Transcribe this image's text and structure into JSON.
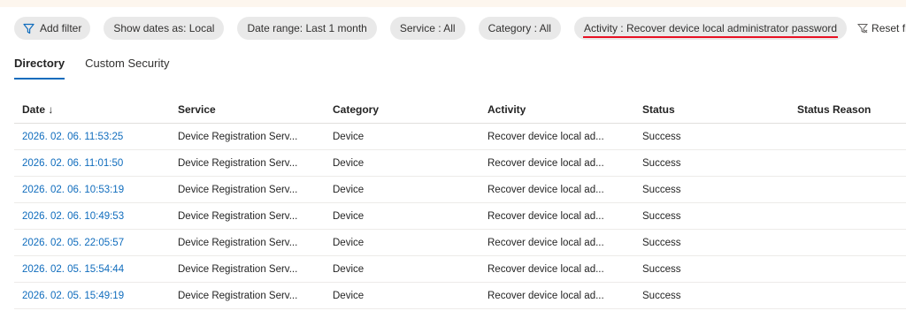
{
  "banner": {
    "text": ""
  },
  "filters": {
    "add_filter": "Add filter",
    "pills": [
      "Show dates as: Local",
      "Date range: Last 1 month",
      "Service : All",
      "Category : All"
    ],
    "activity": "Activity : Recover device local administrator password",
    "reset": "Reset filters"
  },
  "tabs": [
    "Directory",
    "Custom Security"
  ],
  "table": {
    "columns": [
      "Date ↓",
      "Service",
      "Category",
      "Activity",
      "Status",
      "Status Reason"
    ],
    "rows": [
      [
        "2026. 02. 06. 11:53:25",
        "Device Registration Serv...",
        "Device",
        "Recover device local ad...",
        "Success",
        ""
      ],
      [
        "2026. 02. 06. 11:01:50",
        "Device Registration Serv...",
        "Device",
        "Recover device local ad...",
        "Success",
        ""
      ],
      [
        "2026. 02. 06. 10:53:19",
        "Device Registration Serv...",
        "Device",
        "Recover device local ad...",
        "Success",
        ""
      ],
      [
        "2026. 02. 06. 10:49:53",
        "Device Registration Serv...",
        "Device",
        "Recover device local ad...",
        "Success",
        ""
      ],
      [
        "2026. 02. 05. 22:05:57",
        "Device Registration Serv...",
        "Device",
        "Recover device local ad...",
        "Success",
        ""
      ],
      [
        "2026. 02. 05. 15:54:44",
        "Device Registration Serv...",
        "Device",
        "Recover device local ad...",
        "Success",
        ""
      ],
      [
        "2026. 02. 05. 15:49:19",
        "Device Registration Serv...",
        "Device",
        "Recover device local ad...",
        "Success",
        ""
      ]
    ]
  },
  "colors": {
    "accent": "#0f6cbd",
    "highlight": "#e81123",
    "pill": "#e9e9e9"
  }
}
